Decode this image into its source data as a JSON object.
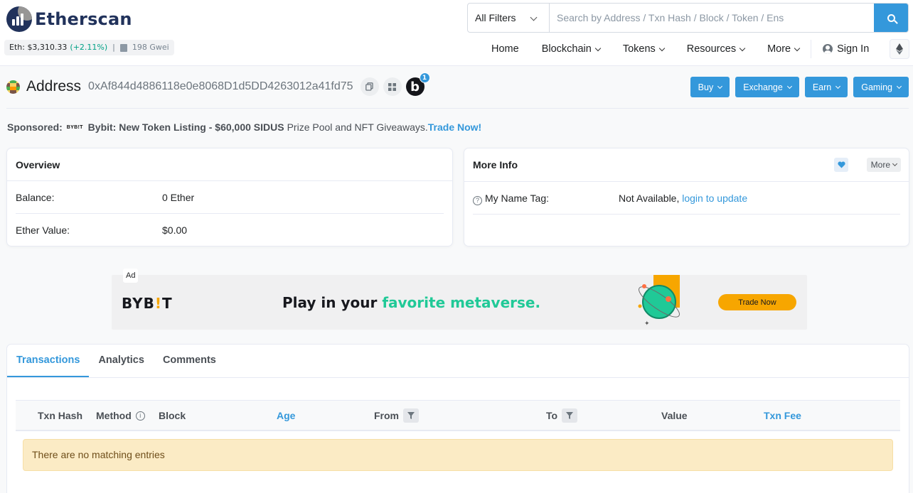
{
  "header": {
    "brand": "Etherscan",
    "eth_price_label": "Eth: $3,310.33",
    "eth_change": "(+2.11%)",
    "separator": "|",
    "gas": "198 Gwei",
    "search": {
      "filter_selected": "All Filters",
      "placeholder": "Search by Address / Txn Hash / Block / Token / Ens"
    },
    "nav": {
      "home": "Home",
      "blockchain": "Blockchain",
      "tokens": "Tokens",
      "resources": "Resources",
      "more": "More",
      "sign_in": "Sign In"
    }
  },
  "address": {
    "title": "Address",
    "hash": "0xAf844d4886118e0e8068D1d5DD4263012a41fd75",
    "badge_letter": "b",
    "badge_count": "1",
    "buttons": {
      "buy": "Buy",
      "exchange": "Exchange",
      "earn": "Earn",
      "gaming": "Gaming"
    }
  },
  "sponsor": {
    "label": "Sponsored:",
    "mini_logo": "BYB!T",
    "headline": "Bybit: New Token Listing - $60,000 SIDUS",
    "text": "Prize Pool and NFT Giveaways.",
    "cta": "Trade Now!"
  },
  "overview": {
    "title": "Overview",
    "balance_label": "Balance:",
    "balance_value": "0 Ether",
    "ether_value_label": "Ether Value:",
    "ether_value": "$0.00"
  },
  "more_info": {
    "title": "More Info",
    "more_label": "More",
    "name_tag_label": "My Name Tag:",
    "name_tag_value": "Not Available,",
    "name_tag_link": "login to update"
  },
  "ad": {
    "label": "Ad",
    "logo": "BYB",
    "logo_tick": "!",
    "logo_end": "T",
    "text_plain": "Play in your",
    "text_green": "favorite metaverse.",
    "cta": "Trade Now"
  },
  "tabs": [
    "Transactions",
    "Analytics",
    "Comments"
  ],
  "table": {
    "headers": [
      "Txn Hash",
      "Method",
      "Block",
      "Age",
      "From",
      "To",
      "Value",
      "Txn Fee"
    ],
    "empty_message": "There are no matching entries"
  },
  "colors": {
    "accent": "#3498db",
    "brand_dark": "#21325b",
    "positive": "#00a186",
    "warning_bg": "#fbebc5"
  }
}
